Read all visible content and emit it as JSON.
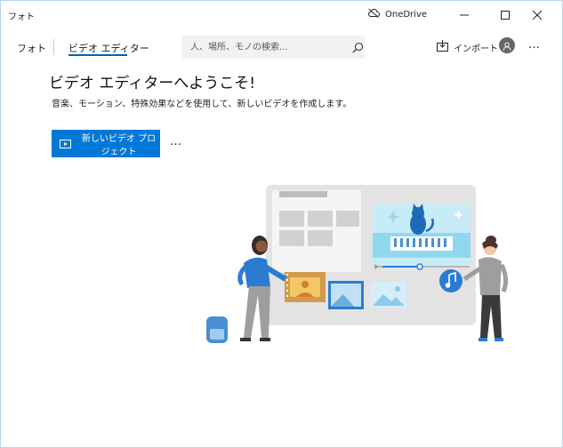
{
  "window": {
    "app_title": "フォト",
    "onedrive_label": "OneDrive"
  },
  "nav": {
    "photos_tab": "フォト",
    "video_editor_tab": "ビデオ エディター",
    "search_placeholder": "人、場所、モノの検索...",
    "import_label": "インポート"
  },
  "main": {
    "heading": "ビデオ エディターへようこそ!",
    "subtext": "音楽、モーション、特殊効果などを使用して、新しいビデオを作成します。",
    "new_project_label": "新しいビデオ プロジェクト",
    "more_label": "…"
  },
  "colors": {
    "accent": "#0078d7",
    "tab_underline": "#0063b1",
    "window_border": "#b8d3ef"
  },
  "icons": [
    "onedrive-cloud-icon",
    "minimize-icon",
    "maximize-icon",
    "close-icon",
    "search-icon",
    "import-icon",
    "avatar-icon",
    "more-icon",
    "video-project-icon"
  ]
}
